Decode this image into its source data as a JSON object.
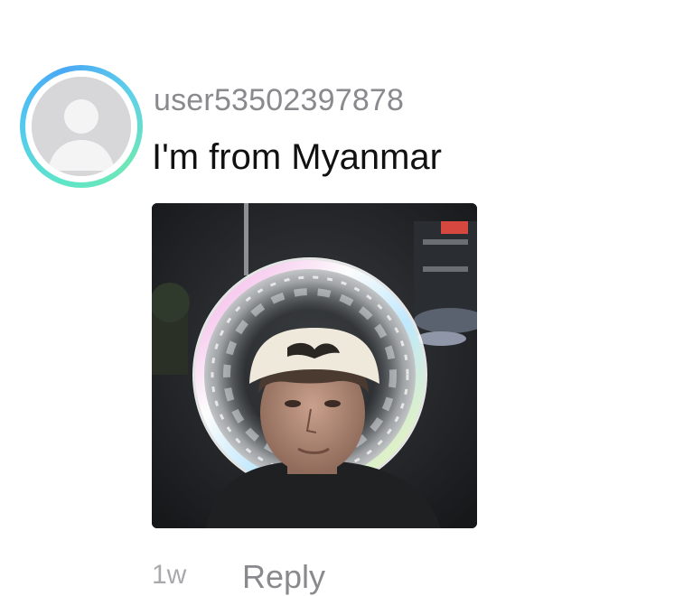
{
  "comment": {
    "username": "user53502397878",
    "text": "I'm from Myanmar",
    "timestamp": "1w",
    "reply_label": "Reply",
    "avatar": {
      "icon": "default-user-icon",
      "ring_colors": [
        "#4aa8f5",
        "#52c9f0",
        "#6ee7b7"
      ]
    },
    "image": {
      "icon": "photo-attachment"
    }
  }
}
